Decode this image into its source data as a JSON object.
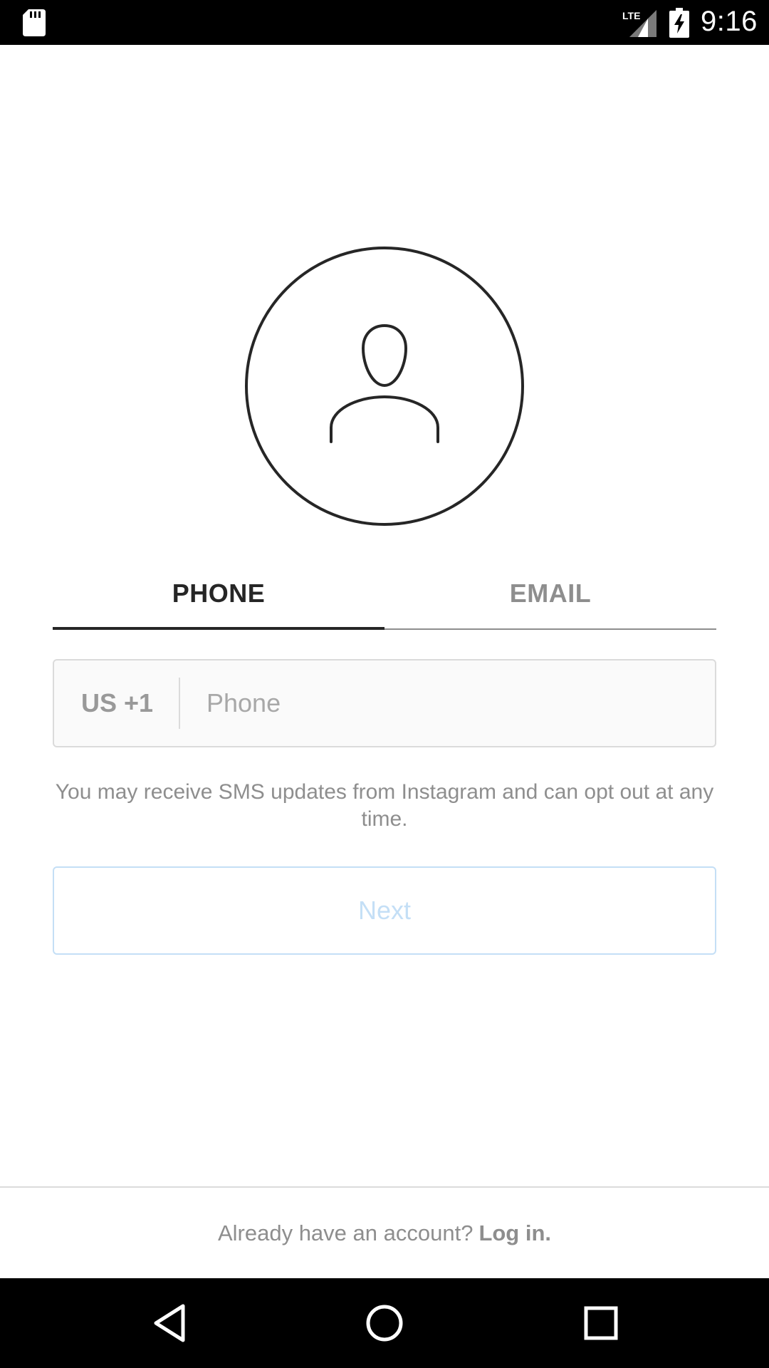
{
  "status_bar": {
    "time": "9:16",
    "network_label": "LTE",
    "icons": [
      "sd-card-icon",
      "lte-signal-icon",
      "battery-charging-icon"
    ]
  },
  "avatar": {
    "icon": "person-icon"
  },
  "tabs": [
    {
      "label": "PHONE",
      "active": true
    },
    {
      "label": "EMAIL",
      "active": false
    }
  ],
  "phone_field": {
    "country_code": "US +1",
    "value": "",
    "placeholder": "Phone"
  },
  "sms_notice": "You may receive SMS updates from Instagram and can opt out at any time.",
  "next_button": {
    "label": "Next",
    "enabled": false
  },
  "login": {
    "prompt": "Already have an account?",
    "link": "Log in."
  },
  "nav_bar": {
    "icons": [
      "back-icon",
      "home-icon",
      "recents-icon"
    ]
  },
  "colors": {
    "text_dark": "#262626",
    "text_grey": "#8e8e8e",
    "border": "#dbdbdb",
    "next_disabled": "#c4dff6"
  }
}
